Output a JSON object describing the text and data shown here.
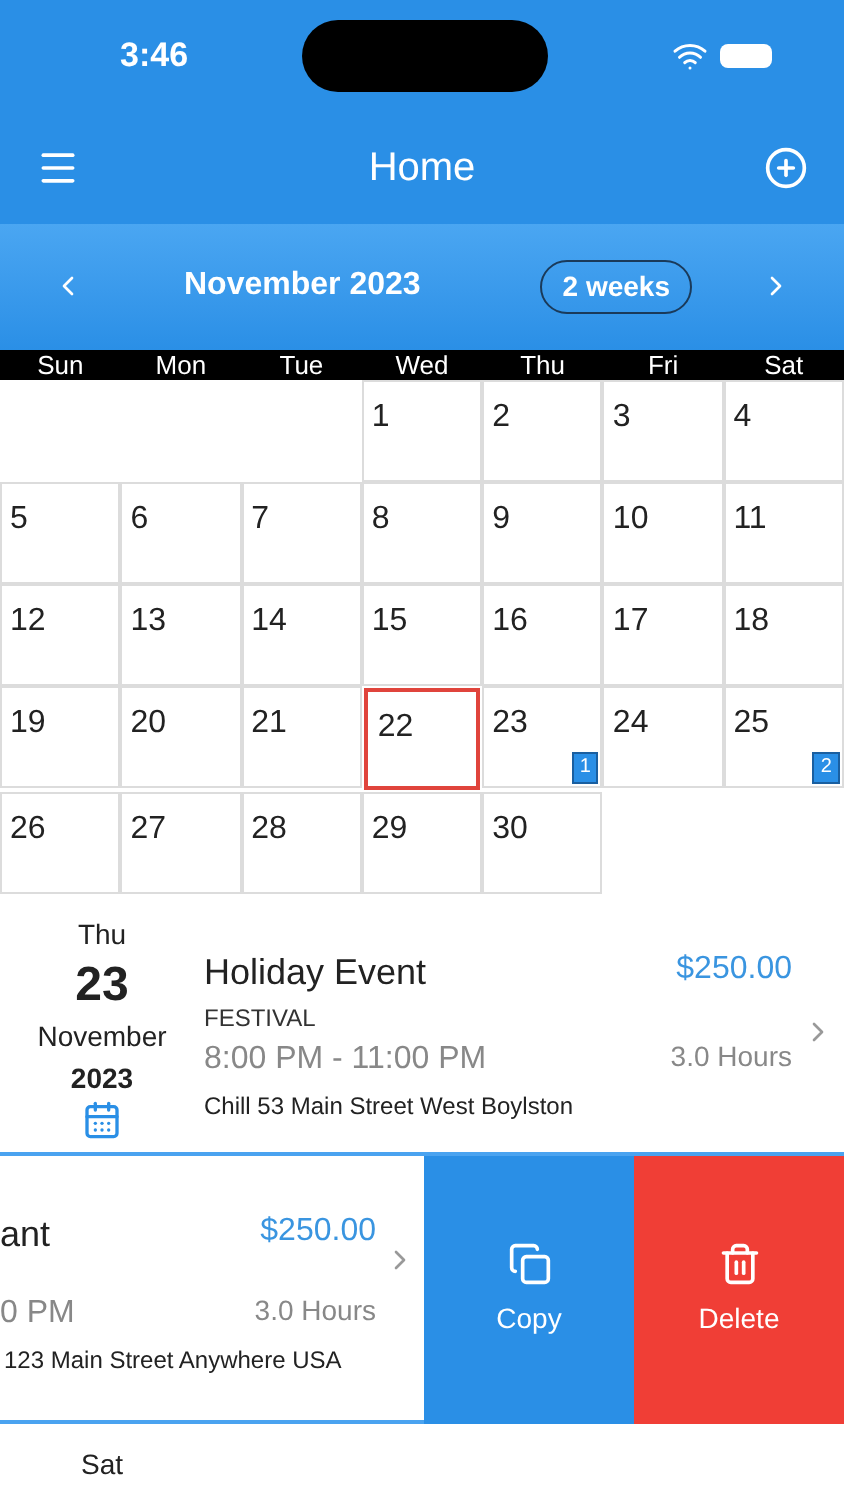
{
  "status_bar": {
    "time": "3:46"
  },
  "header": {
    "title": "Home"
  },
  "calendar": {
    "month": "November 2023",
    "range_button": "2 weeks",
    "weekdays": [
      "Sun",
      "Mon",
      "Tue",
      "Wed",
      "Thu",
      "Fri",
      "Sat"
    ],
    "weeks": [
      [
        {
          "kind": "empty"
        },
        {
          "kind": "empty"
        },
        {
          "kind": "empty"
        },
        {
          "kind": "day",
          "day": "1",
          "selected": false
        },
        {
          "kind": "day",
          "day": "2",
          "selected": false
        },
        {
          "kind": "day",
          "day": "3",
          "selected": false
        },
        {
          "kind": "day",
          "day": "4",
          "selected": false
        }
      ],
      [
        {
          "kind": "day",
          "day": "5",
          "selected": false
        },
        {
          "kind": "day",
          "day": "6",
          "selected": false
        },
        {
          "kind": "day",
          "day": "7",
          "selected": false
        },
        {
          "kind": "day",
          "day": "8",
          "selected": false
        },
        {
          "kind": "day",
          "day": "9",
          "selected": false
        },
        {
          "kind": "day",
          "day": "10",
          "selected": false
        },
        {
          "kind": "day",
          "day": "11",
          "selected": false
        }
      ],
      [
        {
          "kind": "day",
          "day": "12",
          "selected": false
        },
        {
          "kind": "day",
          "day": "13",
          "selected": false
        },
        {
          "kind": "day",
          "day": "14",
          "selected": false
        },
        {
          "kind": "day",
          "day": "15",
          "selected": false
        },
        {
          "kind": "day",
          "day": "16",
          "selected": false
        },
        {
          "kind": "day",
          "day": "17",
          "selected": false
        },
        {
          "kind": "day",
          "day": "18",
          "selected": false
        }
      ],
      [
        {
          "kind": "day",
          "day": "19",
          "selected": false
        },
        {
          "kind": "day",
          "day": "20",
          "selected": false
        },
        {
          "kind": "day",
          "day": "21",
          "selected": false
        },
        {
          "kind": "day",
          "day": "22",
          "selected": true
        },
        {
          "kind": "day",
          "day": "23",
          "selected": false,
          "badge": "1"
        },
        {
          "kind": "day",
          "day": "24",
          "selected": false
        },
        {
          "kind": "day",
          "day": "25",
          "selected": false,
          "badge": "2"
        }
      ],
      [
        {
          "kind": "day",
          "day": "26",
          "selected": false
        },
        {
          "kind": "day",
          "day": "27",
          "selected": false
        },
        {
          "kind": "day",
          "day": "28",
          "selected": false
        },
        {
          "kind": "day",
          "day": "29",
          "selected": false
        },
        {
          "kind": "day",
          "day": "30",
          "selected": false
        },
        {
          "kind": "empty"
        },
        {
          "kind": "empty"
        }
      ]
    ]
  },
  "events": [
    {
      "kind": "full",
      "weekday": "Thu",
      "day": "23",
      "month": "November",
      "year": "2023",
      "title": "Holiday Event",
      "category": "FESTIVAL",
      "time": "8:00 PM - 11:00 PM",
      "price": "$250.00",
      "duration": "3.0 Hours",
      "address": "Chill 53 Main Street West Boylston"
    },
    {
      "kind": "swiped",
      "title": "ant",
      "time": "0 PM",
      "price": "$250.00",
      "duration": "3.0 Hours",
      "address": "123 Main Street Anywhere USA",
      "actions": [
        "Copy",
        "Delete"
      ]
    },
    {
      "kind": "cut",
      "weekday": "Sat"
    }
  ]
}
